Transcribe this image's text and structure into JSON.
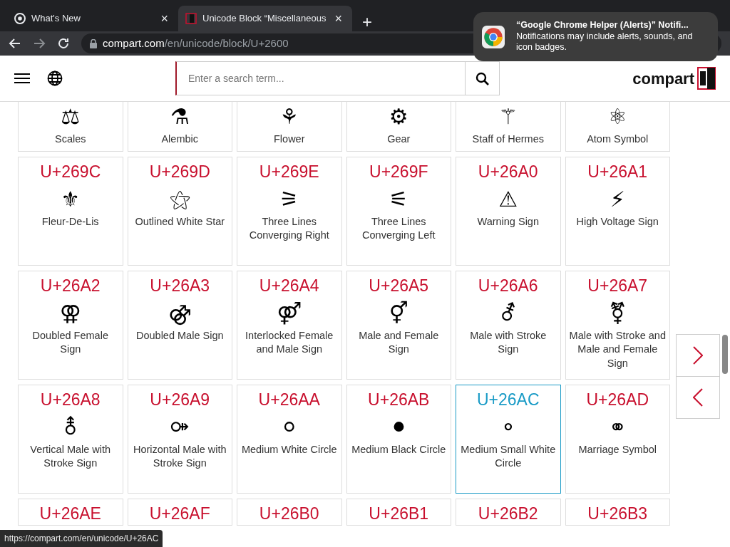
{
  "browser": {
    "tabs": [
      {
        "title": "What's New",
        "kind": "chrome",
        "close": "×",
        "selected": false
      },
      {
        "title": "Unicode Block “Miscellaneous",
        "kind": "site",
        "close": "×",
        "selected": true
      }
    ],
    "new_tab": "+",
    "address": {
      "domain": "compart.com",
      "path": "/en/unicode/block/U+2600"
    }
  },
  "notification": {
    "title": "“Google Chrome Helper (Alerts)” Notifi...",
    "body": "Notifications may include alerts, sounds, and icon badges."
  },
  "header": {
    "search": {
      "placeholder": "Enter a search term..."
    },
    "logo": "compart"
  },
  "cards": [
    {
      "symbol": "⚖",
      "name": "Scales",
      "highlighted": false
    },
    {
      "symbol": "⚗",
      "name": "Alembic",
      "highlighted": false
    },
    {
      "symbol": "⚘",
      "name": "Flower",
      "highlighted": false
    },
    {
      "symbol": "⚙",
      "name": "Gear",
      "highlighted": false
    },
    {
      "symbol": "⚚",
      "name": "Staff of Hermes",
      "highlighted": false
    },
    {
      "symbol": "⚛",
      "name": "Atom Symbol",
      "highlighted": false
    },
    {
      "code": "U+269C",
      "symbol": "⚜",
      "name": "Fleur-De-Lis",
      "highlighted": false
    },
    {
      "code": "U+269D",
      "symbol": "⚝",
      "name": "Outlined White Star",
      "highlighted": false
    },
    {
      "code": "U+269E",
      "symbol": "⚞",
      "name": "Three Lines Converging Right",
      "highlighted": false
    },
    {
      "code": "U+269F",
      "symbol": "⚟",
      "name": "Three Lines Converging Left",
      "highlighted": false
    },
    {
      "code": "U+26A0",
      "symbol": "⚠",
      "name": "Warning Sign",
      "highlighted": false
    },
    {
      "code": "U+26A1",
      "symbol": "⚡",
      "name": "High Voltage Sign",
      "highlighted": false
    },
    {
      "code": "U+26A2",
      "symbol": "⚢",
      "name": "Doubled Female Sign",
      "highlighted": false
    },
    {
      "code": "U+26A3",
      "symbol": "⚣",
      "name": "Doubled Male Sign",
      "highlighted": false
    },
    {
      "code": "U+26A4",
      "symbol": "⚤",
      "name": "Interlocked Female and Male Sign",
      "highlighted": false
    },
    {
      "code": "U+26A5",
      "symbol": "⚥",
      "name": "Male and Female Sign",
      "highlighted": false
    },
    {
      "code": "U+26A6",
      "symbol": "⚦",
      "name": "Male with Stroke Sign",
      "highlighted": false
    },
    {
      "code": "U+26A7",
      "symbol": "⚧",
      "name": "Male with Stroke and Male and Female Sign",
      "highlighted": false
    },
    {
      "code": "U+26A8",
      "symbol": "⚨",
      "name": "Vertical Male with Stroke Sign",
      "highlighted": false
    },
    {
      "code": "U+26A9",
      "symbol": "⚩",
      "name": "Horizontal Male with Stroke Sign",
      "highlighted": false
    },
    {
      "code": "U+26AA",
      "symbol": "⚪",
      "name": "Medium White Circle",
      "highlighted": false
    },
    {
      "code": "U+26AB",
      "symbol": "⚫",
      "name": "Medium Black Circle",
      "highlighted": false
    },
    {
      "code": "U+26AC",
      "symbol": "⚬",
      "name": "Medium Small White Circle",
      "highlighted": true
    },
    {
      "code": "U+26AD",
      "symbol": "⚭",
      "name": "Marriage Symbol",
      "highlighted": false
    },
    {
      "code": "U+26AE",
      "highlighted": false
    },
    {
      "code": "U+26AF",
      "highlighted": false
    },
    {
      "code": "U+26B0",
      "highlighted": false
    },
    {
      "code": "U+26B1",
      "highlighted": false
    },
    {
      "code": "U+26B2",
      "highlighted": false
    },
    {
      "code": "U+26B3",
      "highlighted": false
    }
  ],
  "status_url": "https://compart.com/en/unicode/U+26AC"
}
